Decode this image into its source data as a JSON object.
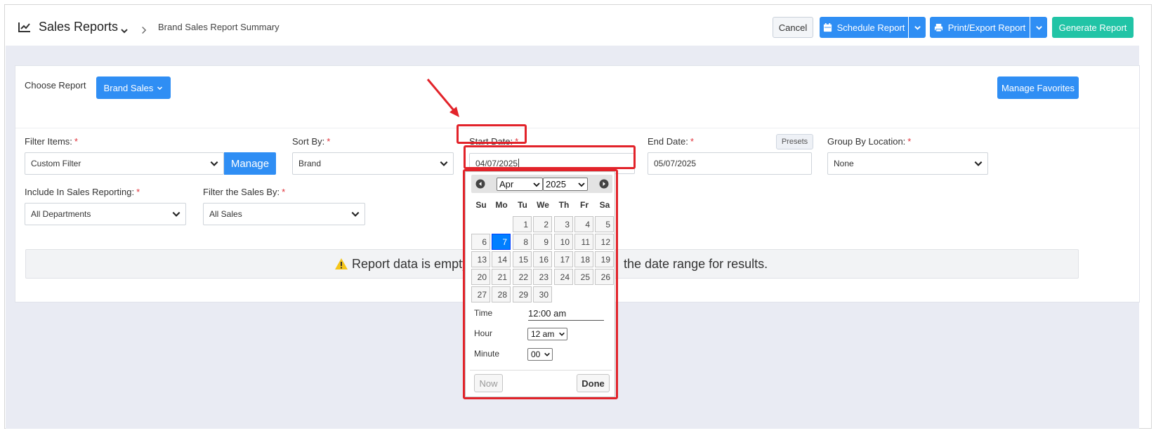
{
  "header": {
    "title": "Sales Reports",
    "breadcrumb": "Brand Sales Report Summary",
    "cancel": "Cancel",
    "schedule": "Schedule Report",
    "print_export": "Print/Export Report",
    "generate": "Generate Report"
  },
  "report": {
    "choose_label": "Choose Report",
    "selected": "Brand Sales",
    "manage_favorites": "Manage Favorites"
  },
  "filters": {
    "filter_items": {
      "label": "Filter Items:",
      "value": "Custom Filter",
      "manage": "Manage"
    },
    "sort_by": {
      "label": "Sort By:",
      "value": "Brand"
    },
    "start_date": {
      "label": "Start Date:",
      "value": "04/07/2025"
    },
    "end_date": {
      "label": "End Date:",
      "value": "05/07/2025",
      "presets": "Presets"
    },
    "group_by_location": {
      "label": "Group By Location:",
      "value": "None"
    },
    "include_in_sales": {
      "label": "Include In Sales Reporting:",
      "value": "All Departments"
    },
    "filter_sales_by": {
      "label": "Filter the Sales By:",
      "value": "All Sales"
    },
    "required_mark": "*"
  },
  "alert": {
    "text_left": "Report data is empty",
    "text_right": "the date range for results."
  },
  "datepicker": {
    "month": "Apr",
    "year": "2025",
    "weekdays": [
      "Su",
      "Mo",
      "Tu",
      "We",
      "Th",
      "Fr",
      "Sa"
    ],
    "days": [
      "1",
      "2",
      "3",
      "4",
      "5",
      "6",
      "7",
      "8",
      "9",
      "10",
      "11",
      "12",
      "13",
      "14",
      "15",
      "16",
      "17",
      "18",
      "19",
      "20",
      "21",
      "22",
      "23",
      "24",
      "25",
      "26",
      "27",
      "28",
      "29",
      "30"
    ],
    "selected_day": "7",
    "time_label": "Time",
    "time_value": "12:00 am",
    "hour_label": "Hour",
    "hour_value": "12 am",
    "minute_label": "Minute",
    "minute_value": "00",
    "now": "Now",
    "done": "Done"
  },
  "colors": {
    "primary": "#2f8ef4",
    "teal": "#21c4a6",
    "highlight": "#e2232a",
    "required": "#e0323a",
    "warning": "#f5c518"
  }
}
